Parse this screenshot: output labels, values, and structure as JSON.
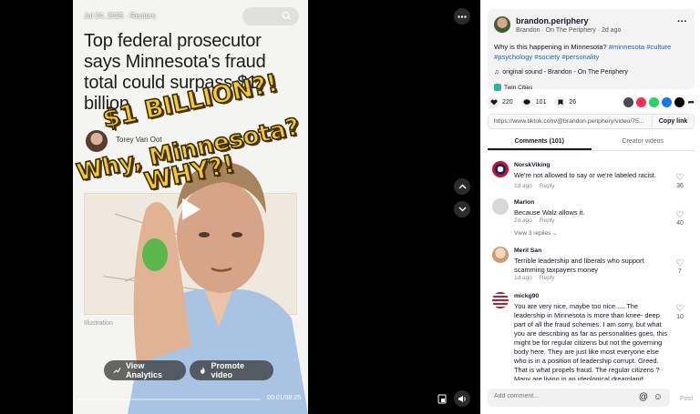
{
  "video": {
    "date_line": "Jul 24, 2025 · Reuters",
    "headline": "Top federal prosecutor says Minnesota's fraud total could surpass $1 billion",
    "author": "Torey Van Oot",
    "caption": "Illustration",
    "overlay_lines": [
      "$1 BILLION?!",
      "Why, Minnesota?",
      "WHY?!"
    ],
    "view_analytics": "View Analytics",
    "promote": "Promote video",
    "time": "00:01/08:25",
    "progress": 0.01
  },
  "post": {
    "username": "brandon.periphery",
    "subline": "Brandon · On The Periphery · 2d ago",
    "description_text": "Why is this happening in Minnesota?",
    "hashtags": [
      "#minnesota",
      "#culture",
      "#psychology",
      "#society",
      "#personality"
    ],
    "sound": "original sound - Brandon - On The Periphery",
    "location": "Twin Cities",
    "likes": "220",
    "comments_count": "101",
    "saves": "26",
    "link": "https://www.tiktok.com/@brandon.periphery/video/75...",
    "copy_link": "Copy link"
  },
  "tabs": [
    "Comments (101)",
    "Creator videos"
  ],
  "comments": [
    {
      "user": "NorskViking",
      "text": "We're not allowed to say or we're labeled racist.",
      "time": "1d ago",
      "reply": "Reply",
      "likes": "36",
      "avatar_color": "#c8102e"
    },
    {
      "user": "Marlon",
      "text": "Because Walz allows it.",
      "time": "2d ago",
      "reply": "Reply",
      "likes": "40",
      "avatar_color": "#d8d8da",
      "view_replies": "View 3 replies"
    },
    {
      "user": "Meril San",
      "text": "Terrible leadership and liberals who support scamming taxpayers money",
      "time": "1d ago",
      "reply": "Reply",
      "likes": "7",
      "avatar_color": "#e9c9a8"
    },
    {
      "user": "mickg90",
      "text": "You are very nice, maybe too nice..... The leadership in Minnesota is more than knee- deep part of all the fraud schemes. I am sorry, but what you are describing as far as personalities goes, this might be for regular citizens but not the governing body here. They are just like most everyone else who is in a position of leadership corrupt. Greed. That is what propels fraud. The regular citizens ? Many are living in an ideological dreamland, especially in the cities. However, Jacobson's stands in a different place.",
      "likes": "10",
      "avatar_color": "#b22234"
    }
  ],
  "add_comment_placeholder": "Add comment...",
  "post_button": "Post"
}
